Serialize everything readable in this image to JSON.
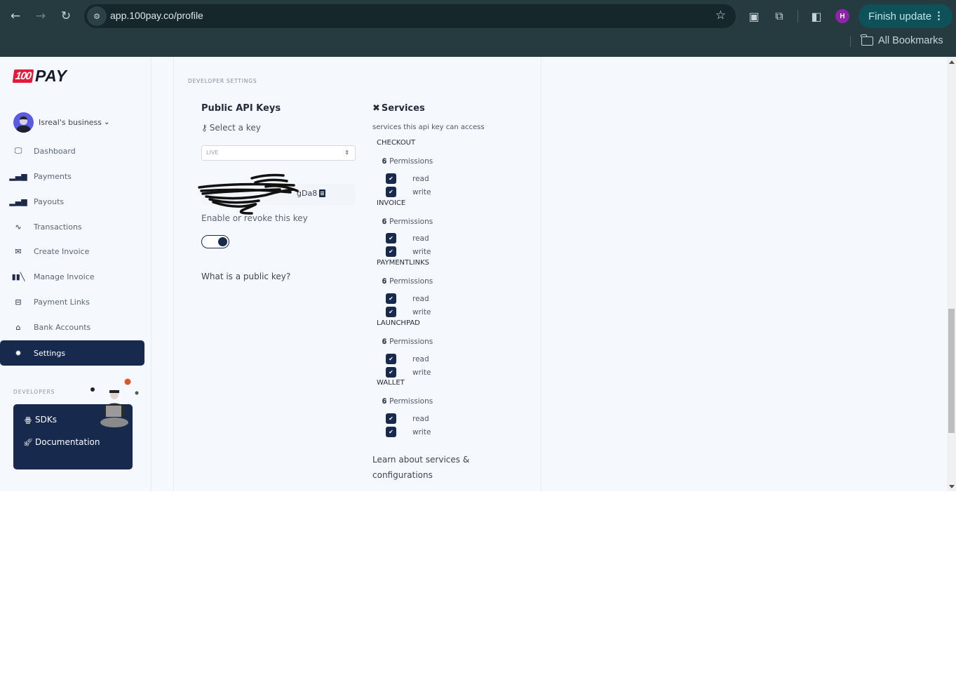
{
  "browser": {
    "url": "app.100pay.co/profile",
    "profile_initial": "H",
    "finish_update_label": "Finish update",
    "bookmarks_label": "All Bookmarks"
  },
  "sidebar": {
    "logo_badge": "100",
    "logo_word": "PAY",
    "business_name": "Isreal's business",
    "items": [
      {
        "label": "Dashboard",
        "icon": "monitor-icon",
        "active": false
      },
      {
        "label": "Payments",
        "icon": "bar-chart-icon",
        "active": false
      },
      {
        "label": "Payouts",
        "icon": "bar-chart-icon",
        "active": false
      },
      {
        "label": "Transactions",
        "icon": "pulse-icon",
        "active": false
      },
      {
        "label": "Create Invoice",
        "icon": "envelope-icon",
        "active": false
      },
      {
        "label": "Manage Invoice",
        "icon": "books-icon",
        "active": false
      },
      {
        "label": "Payment Links",
        "icon": "inbox-icon",
        "active": false
      },
      {
        "label": "Bank Accounts",
        "icon": "bank-icon",
        "active": false
      },
      {
        "label": "Settings",
        "icon": "gear-icon",
        "active": true
      }
    ],
    "developers_heading": "DEVELOPERS",
    "developer_links": [
      {
        "label": "SDKs",
        "icon": "sdk-icon"
      },
      {
        "label": "Documentation",
        "icon": "rocket-icon"
      }
    ]
  },
  "main": {
    "section_label": "DEVELOPER SETTINGS",
    "api_keys": {
      "title": "Public API Keys",
      "select_label": "Select a key",
      "selected_key": "LIVE",
      "key_value_visible": "gDa8",
      "enable_label": "Enable or revoke this key",
      "enabled": true,
      "help_link": "What is a public key?"
    },
    "services": {
      "title": "Services",
      "subtitle": "services this api key can access",
      "permissions_label": "Permissions",
      "items": [
        {
          "name": "CHECKOUT",
          "read": true,
          "write": true
        },
        {
          "name": "INVOICE",
          "read": true,
          "write": true
        },
        {
          "name": "PAYMENTLINKS",
          "read": true,
          "write": true
        },
        {
          "name": "LAUNCHPAD",
          "read": true,
          "write": true
        },
        {
          "name": "WALLET",
          "read": true,
          "write": true
        }
      ],
      "read_label": "read",
      "write_label": "write",
      "learn_link": "Learn about services & configurations"
    }
  }
}
